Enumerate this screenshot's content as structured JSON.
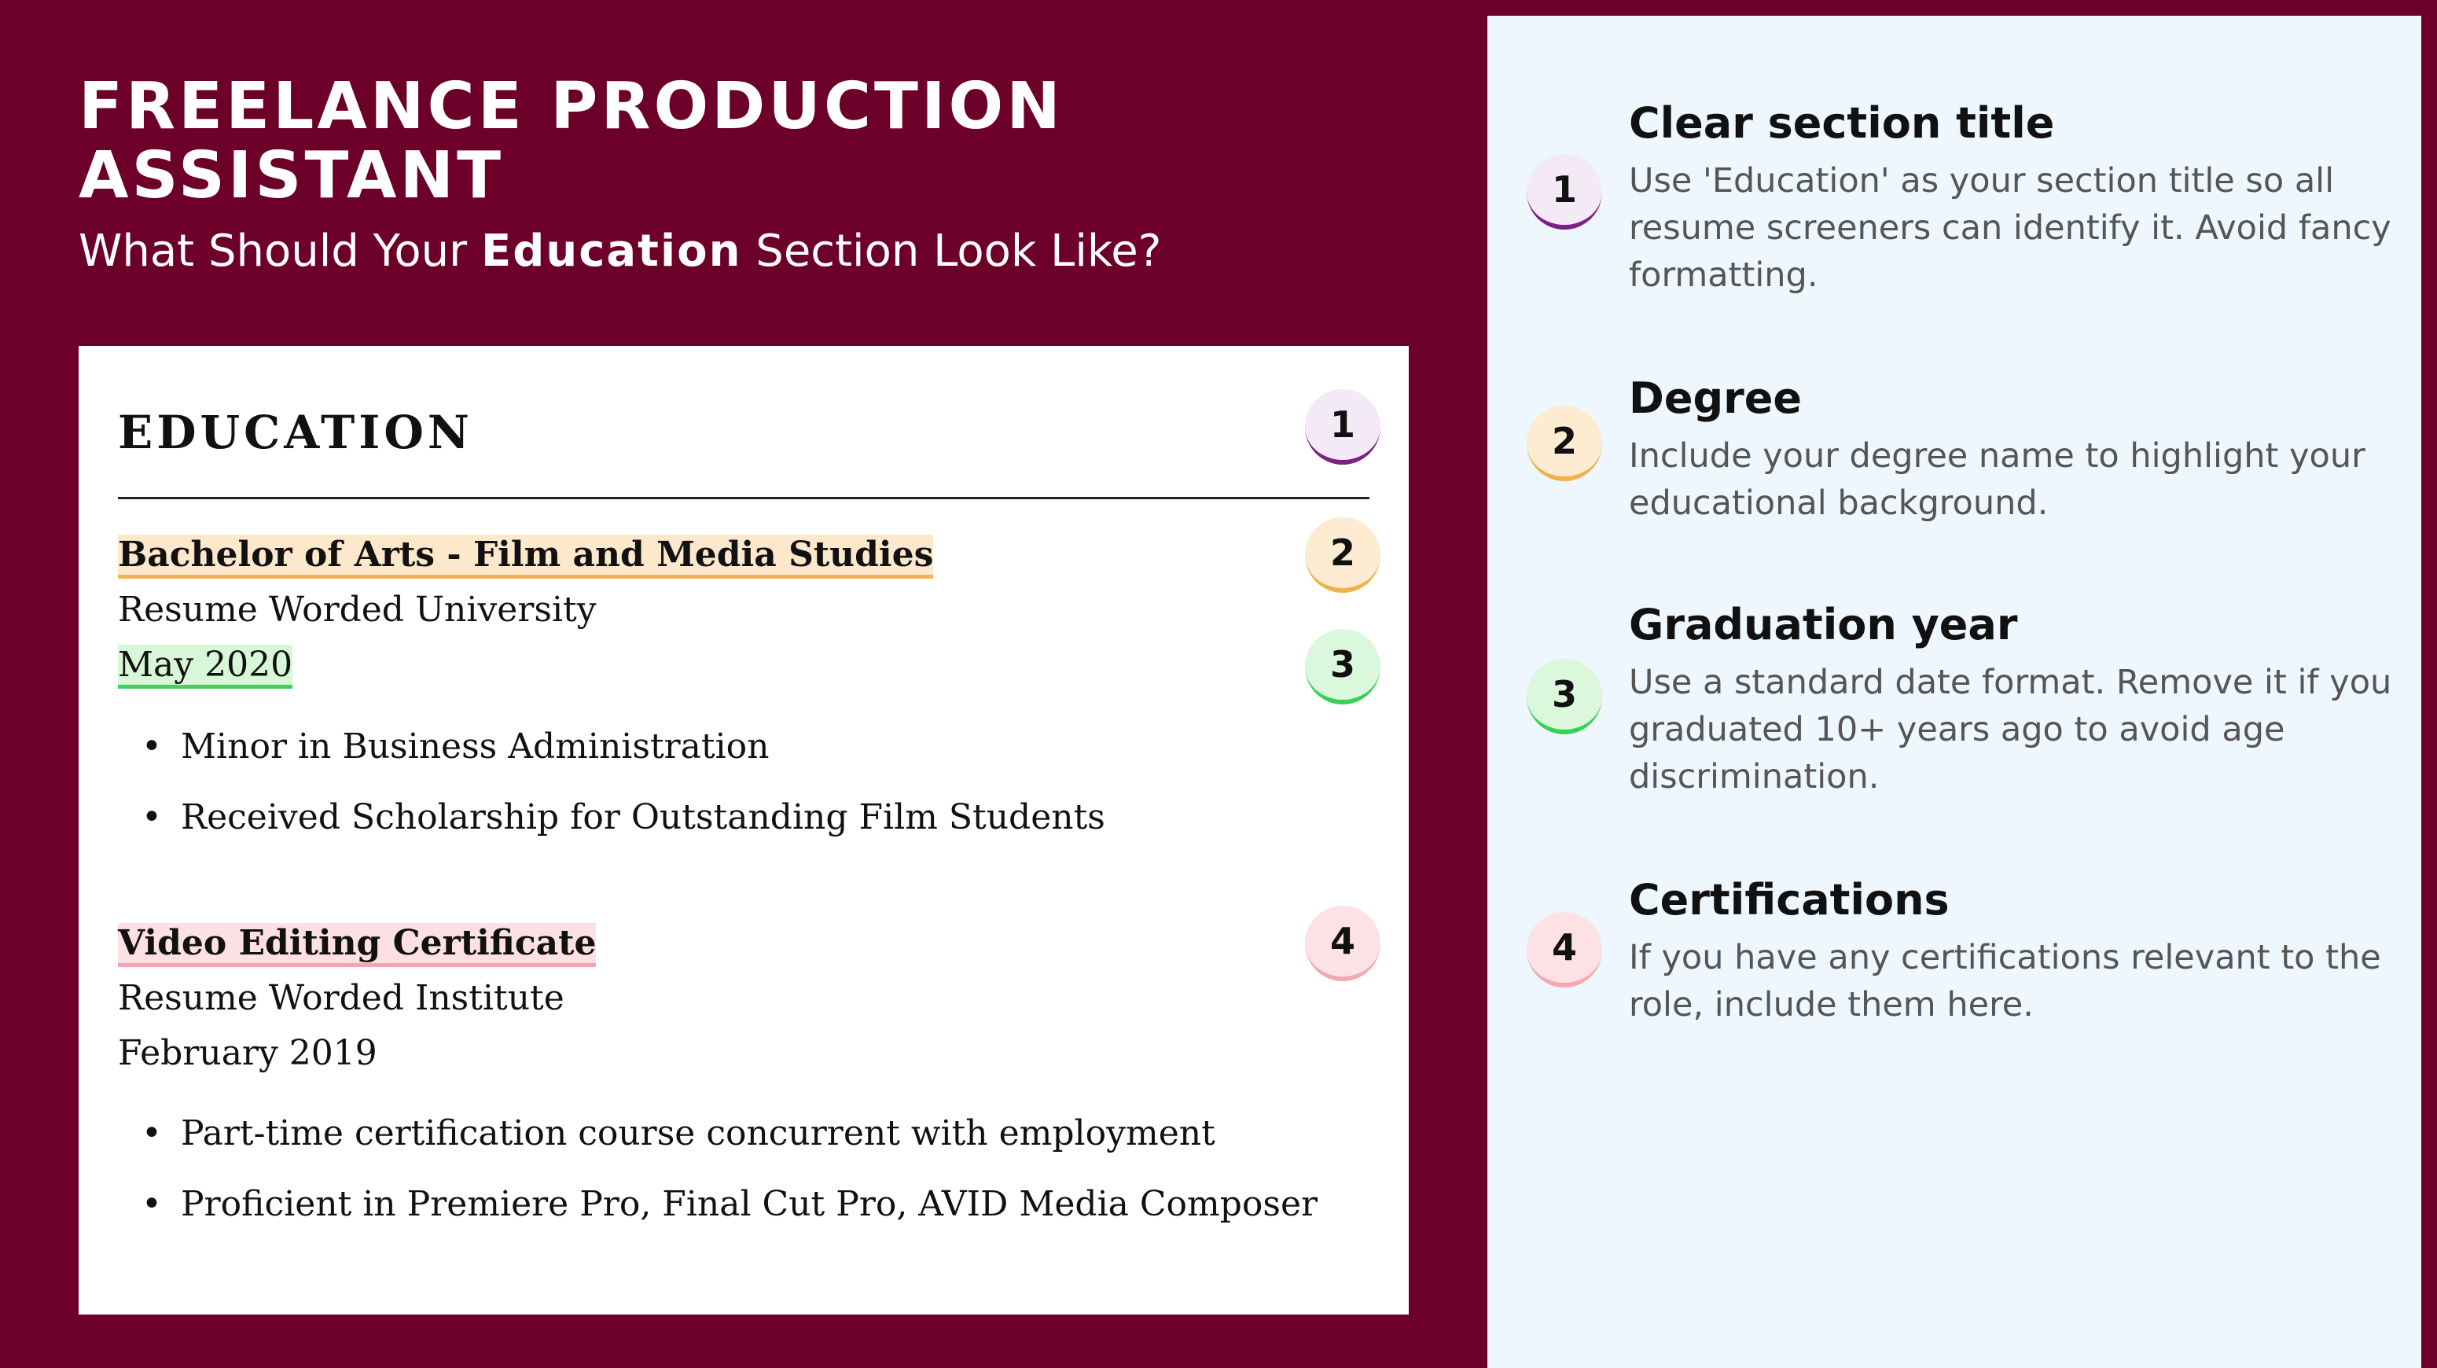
{
  "header": {
    "title": "FREELANCE PRODUCTION ASSISTANT",
    "subtitle_pre": "What Should Your ",
    "subtitle_bold": "Education",
    "subtitle_post": " Section Look Like?"
  },
  "resume": {
    "section_heading": "EDUCATION",
    "entries": [
      {
        "title": "Bachelor of Arts - Film and Media Studies",
        "institution": "Resume Worded University",
        "date": "May 2020",
        "bullets": [
          "Minor in Business Administration",
          "Received Scholarship for Outstanding Film Students"
        ]
      },
      {
        "title": "Video Editing Certificate",
        "institution": "Resume Worded Institute",
        "date": "February 2019",
        "bullets": [
          "Part-time certification course concurrent with employment",
          "Proficient in Premiere Pro, Final Cut Pro, AVID Media Composer"
        ]
      }
    ]
  },
  "badges": [
    "1",
    "2",
    "3",
    "4"
  ],
  "tips": [
    {
      "number": "1",
      "title": "Clear section title",
      "body": "Use 'Education' as your section title so all resume screeners can identify it. Avoid fancy formatting."
    },
    {
      "number": "2",
      "title": "Degree",
      "body": "Include your degree name to highlight your educational background."
    },
    {
      "number": "3",
      "title": "Graduation year",
      "body": "Use a standard date format. Remove it if you graduated 10+ years ago to avoid age discrimination."
    },
    {
      "number": "4",
      "title": "Certifications",
      "body": "If you have any certifications relevant to the role, include them here."
    }
  ],
  "colors": {
    "background": "#6c0029",
    "panel": "#eef6fe",
    "badge1": "#7e1f86",
    "badge2": "#f0b24b",
    "badge3": "#39d05a",
    "badge4": "#f4a9b2"
  }
}
